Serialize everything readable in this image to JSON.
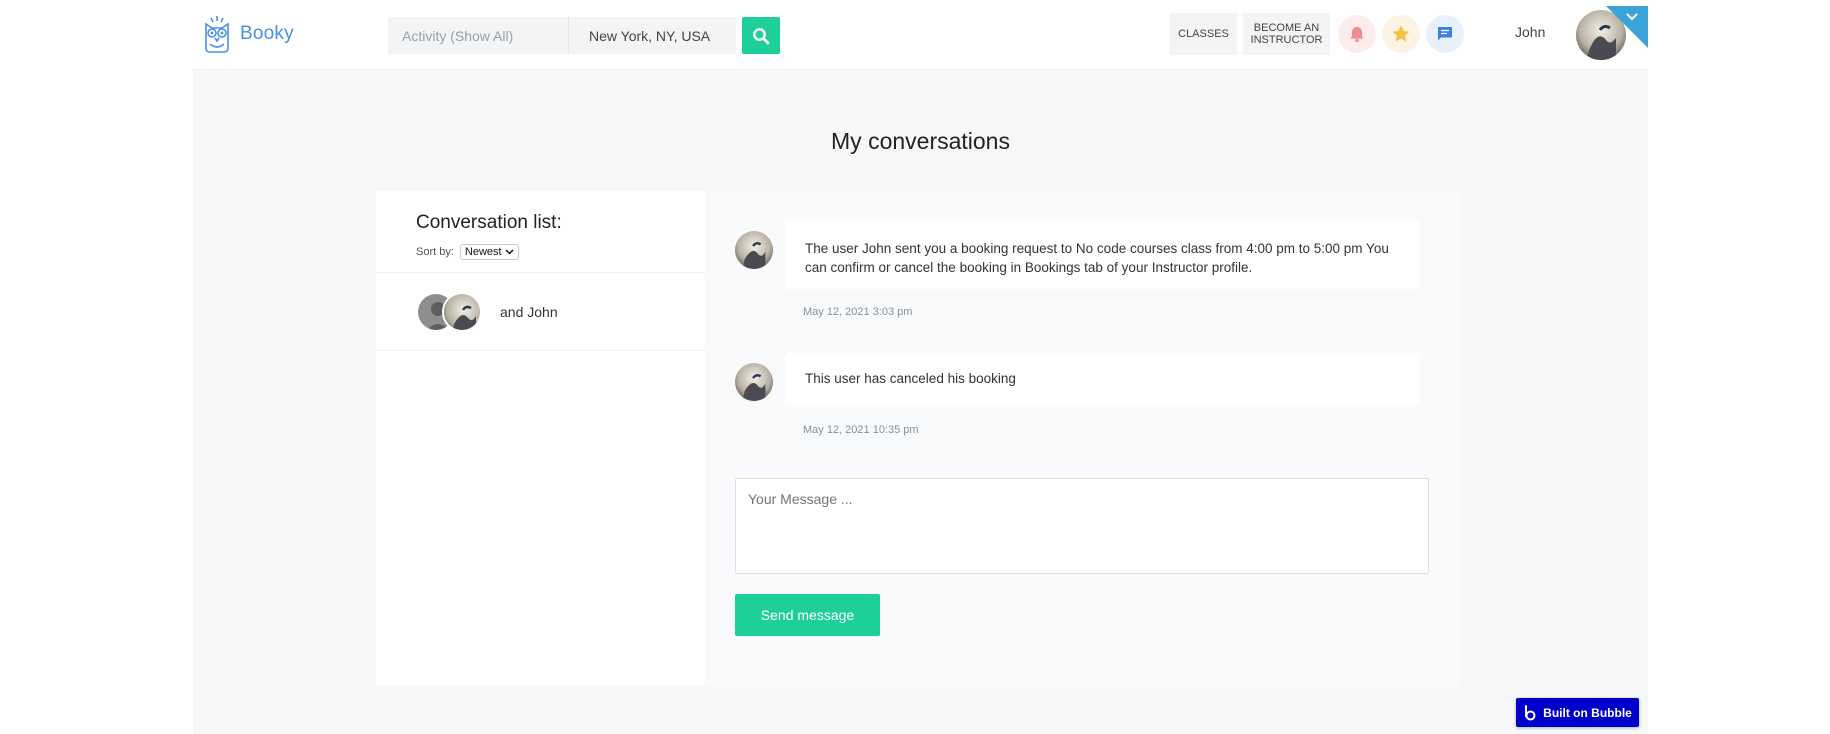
{
  "brand": {
    "name": "Booky",
    "color": "#4a90e2"
  },
  "search": {
    "activity_placeholder": "Activity (Show All)",
    "location_value": "New York, NY, USA",
    "button_icon": "search-icon"
  },
  "nav": {
    "classes_label": "CLASSES",
    "become_instructor_label": "BECOME AN INSTRUCTOR",
    "icons": [
      "bell-icon",
      "star-icon",
      "chat-icon"
    ]
  },
  "user": {
    "name": "John"
  },
  "page": {
    "title": "My conversations"
  },
  "conversation_list": {
    "title": "Conversation list:",
    "sort_label": "Sort by:",
    "sort_value": "Newest",
    "items": [
      {
        "label": "and John"
      }
    ]
  },
  "messages": [
    {
      "text": "The user John sent you a booking request to  No code courses class from 4:00 pm  to 5:00 pm You can confirm or cancel the booking in Bookings tab of your Instructor profile.",
      "time": "May 12, 2021 3:03 pm"
    },
    {
      "text": "This user has canceled his booking",
      "time": "May 12, 2021 10:35 pm"
    }
  ],
  "composer": {
    "placeholder": "Your Message ...",
    "send_label": "Send message"
  },
  "badge": {
    "label": "Built on Bubble"
  },
  "colors": {
    "accent": "#1ecf9a",
    "corner": "#3aa3d8",
    "bubble_badge": "#0000cc"
  }
}
